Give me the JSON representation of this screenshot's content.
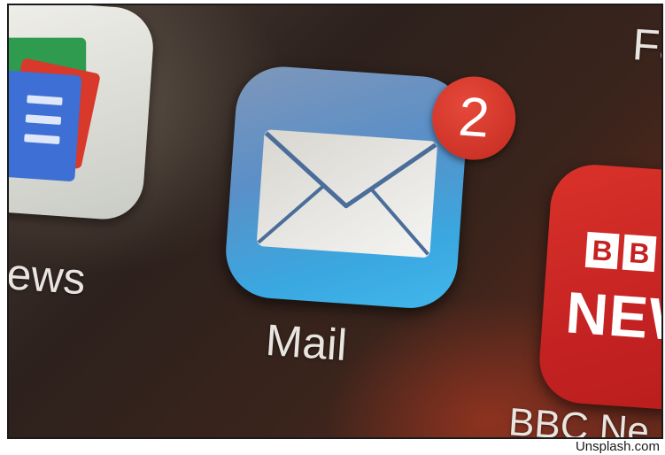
{
  "photo": {
    "apps": {
      "news": {
        "label": "lews"
      },
      "mail": {
        "label": "Mail",
        "badge_count": "2"
      },
      "bbc": {
        "label": "BBC Ne",
        "logo_letters": [
          "B",
          "B"
        ],
        "logo_news": "NEW"
      },
      "top_right": {
        "label": "Fa"
      }
    }
  },
  "credit": "Unsplash.com"
}
